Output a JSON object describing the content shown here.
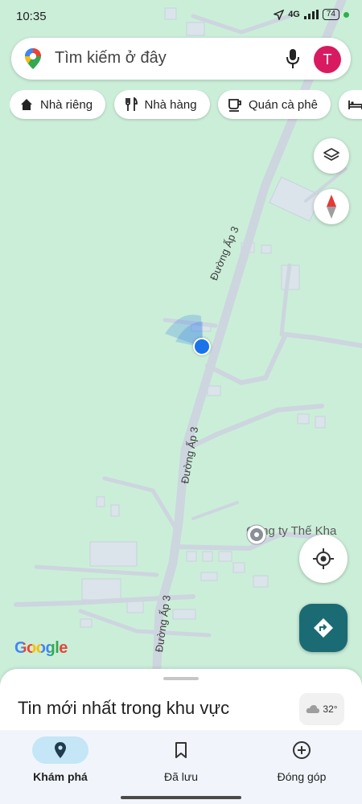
{
  "status_bar": {
    "time": "10:35",
    "network": "4G",
    "battery": "74"
  },
  "search": {
    "placeholder": "Tìm kiếm ở đây",
    "avatar_initial": "T"
  },
  "chips": [
    {
      "label": "Nhà riêng",
      "icon": "home-icon"
    },
    {
      "label": "Nhà hàng",
      "icon": "restaurant-icon"
    },
    {
      "label": "Quán cà phê",
      "icon": "coffee-icon"
    },
    {
      "label": "",
      "icon": "hotel-icon"
    }
  ],
  "map": {
    "roads": [
      {
        "label": "Đường Ấp 3"
      },
      {
        "label": "Đường Ấp 3"
      },
      {
        "label": "Đường Ấp 3"
      }
    ],
    "poi": {
      "label": "Công ty Thế Kha"
    },
    "attribution": "Google"
  },
  "sheet": {
    "title": "Tin mới nhất trong khu vực",
    "weather": "32°"
  },
  "nav": [
    {
      "label": "Khám phá",
      "icon": "explore-pin-icon",
      "active": true
    },
    {
      "label": "Đã lưu",
      "icon": "bookmark-icon",
      "active": false
    },
    {
      "label": "Đóng góp",
      "icon": "add-circle-icon",
      "active": false
    }
  ],
  "colors": {
    "map_bg": "#cbeed9",
    "road": "#cdd5df",
    "location_dot": "#1a73e8",
    "directions_fab": "#1a6b73",
    "avatar": "#d81b60",
    "nav_active": "#c4e6f7"
  }
}
